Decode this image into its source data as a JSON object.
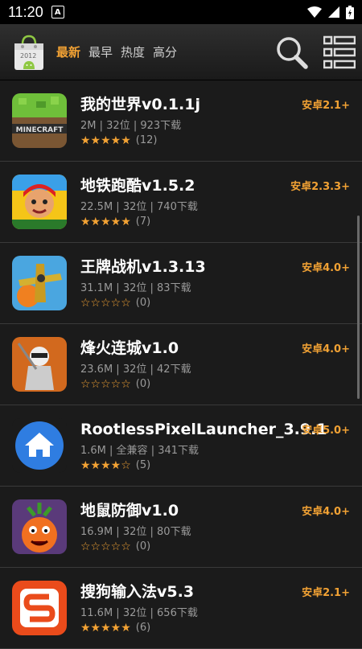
{
  "status": {
    "time": "11:20",
    "notif": "A"
  },
  "tabs": [
    "最新",
    "最早",
    "热度",
    "高分"
  ],
  "logo_text": "2012",
  "apps": [
    {
      "name": "我的世界v0.1.1j",
      "size": "2M",
      "arch": "32位",
      "downloads": "923下载",
      "stars": "★★★★★",
      "count": "(12)",
      "req": "安卓2.1+",
      "icon": "minecraft-icon"
    },
    {
      "name": "地铁跑酷v1.5.2",
      "size": "22.5M",
      "arch": "32位",
      "downloads": "740下载",
      "stars": "★★★★★",
      "count": "(7)",
      "req": "安卓2.3.3+",
      "icon": "subway-surfers-icon"
    },
    {
      "name": "王牌战机v1.3.13",
      "size": "31.1M",
      "arch": "32位",
      "downloads": "83下载",
      "stars": "☆☆☆☆☆",
      "count": "(0)",
      "req": "安卓4.0+",
      "icon": "fighter-plane-icon"
    },
    {
      "name": "烽火连城v1.0",
      "size": "23.6M",
      "arch": "32位",
      "downloads": "42下载",
      "stars": "☆☆☆☆☆",
      "count": "(0)",
      "req": "安卓4.0+",
      "icon": "ninja-icon"
    },
    {
      "name": "RootlessPixelLauncher_3.9.1",
      "size": "1.6M",
      "arch": "全兼容",
      "downloads": "341下载",
      "stars": "★★★★☆",
      "count": "(5)",
      "req": "安卓5.0+",
      "icon": "home-launcher-icon"
    },
    {
      "name": "地鼠防御v1.0",
      "size": "16.9M",
      "arch": "32位",
      "downloads": "80下载",
      "stars": "☆☆☆☆☆",
      "count": "(0)",
      "req": "安卓4.0+",
      "icon": "carrot-monster-icon"
    },
    {
      "name": "搜狗输入法v5.3",
      "size": "11.6M",
      "arch": "32位",
      "downloads": "656下载",
      "stars": "★★★★★",
      "count": "(6)",
      "req": "安卓2.1+",
      "icon": "sogou-icon"
    }
  ]
}
